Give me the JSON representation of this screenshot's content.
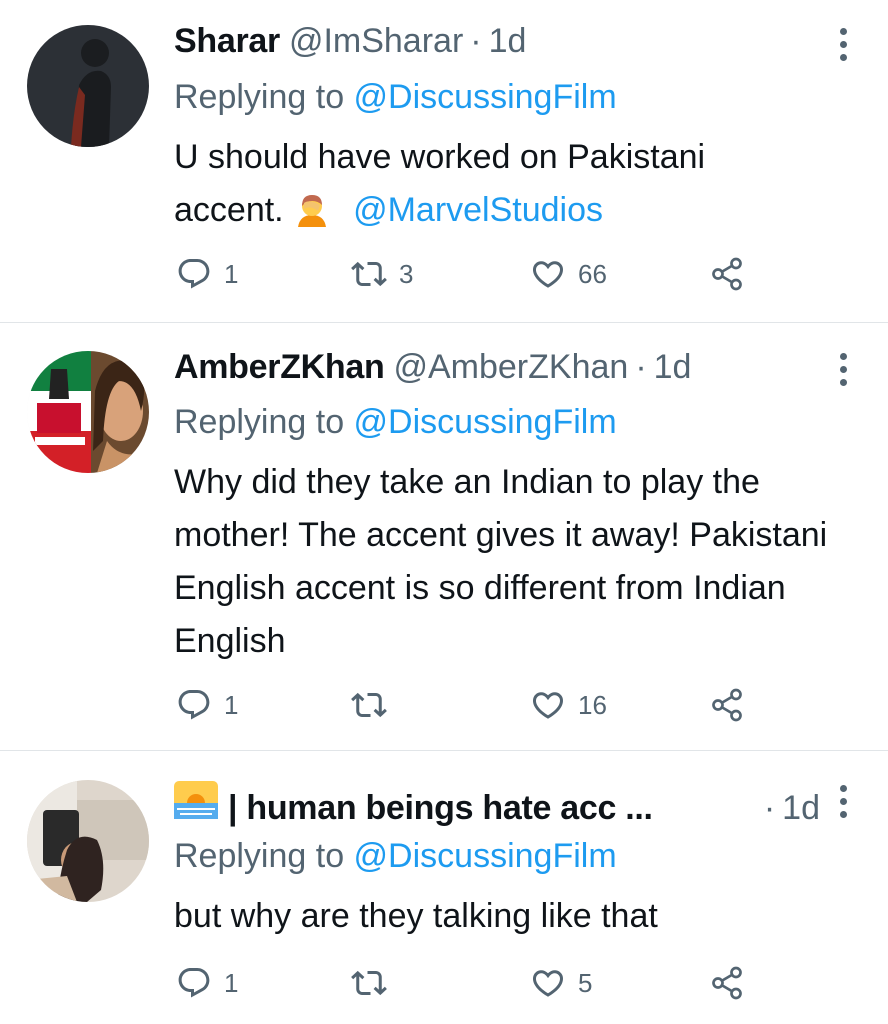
{
  "tweets": [
    {
      "name": "Sharar",
      "handle": "@ImSharar",
      "dot": "·",
      "time": "1d",
      "replying_prefix": "Replying to ",
      "replying_to": "@DiscussingFilm",
      "text_line1": "U should have worked on Pakistani",
      "text_line2_prefix": "accent.",
      "text_line2_mention": "@MarvelStudios",
      "emoji": "person-facepalming-emoji",
      "replies": "1",
      "retweets": "3",
      "likes": "66"
    },
    {
      "name": "AmberZKhan",
      "handle": "@AmberZKhan",
      "dot": "·",
      "time": "1d",
      "replying_prefix": "Replying to ",
      "replying_to": "@DiscussingFilm",
      "text": "Why did they take an Indian to play the mother! The accent gives it away! Pakistani English accent is so different from Indian English",
      "replies": "1",
      "retweets": "",
      "likes": "16"
    },
    {
      "name": "| human beings hate acc ...",
      "handle": "",
      "dot": "·",
      "time": "1d",
      "name_emoji": "sunrise-emoji",
      "replying_prefix": "Replying to ",
      "replying_to": "@DiscussingFilm",
      "text": "but why are they talking like that",
      "replies": "1",
      "retweets": "",
      "likes": "5"
    }
  ],
  "colors": {
    "link": "#1d9bf0",
    "secondary": "#536471",
    "text": "#0f1419",
    "divider": "#e1e5e8"
  }
}
